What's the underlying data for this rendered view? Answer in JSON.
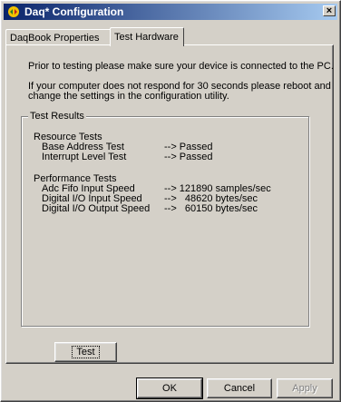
{
  "window": {
    "title": "Daq* Configuration",
    "close_glyph": "×"
  },
  "tabs": [
    {
      "label": "DaqBook Properties"
    },
    {
      "label": "Test Hardware"
    }
  ],
  "instructions": {
    "line1": "Prior to testing please make sure your device is connected to the PC.",
    "line2": "If your computer does not respond for 30 seconds please reboot and",
    "line3": "change the settings in the configuration utility."
  },
  "results": {
    "group_label": "Test Results",
    "resource_header": "Resource Tests",
    "resource": [
      {
        "name": "Base Address Test",
        "value": "--> Passed"
      },
      {
        "name": "Interrupt Level Test",
        "value": "--> Passed"
      }
    ],
    "performance_header": "Performance Tests",
    "performance": [
      {
        "name": "Adc Fifo Input Speed",
        "value": "--> 121890 samples/sec"
      },
      {
        "name": "Digital I/O Input Speed",
        "value": "-->   48620 bytes/sec"
      },
      {
        "name": "Digital I/O Output Speed",
        "value": "-->   60150 bytes/sec"
      }
    ]
  },
  "buttons": {
    "test": "Test",
    "ok": "OK",
    "cancel": "Cancel",
    "apply": "Apply"
  },
  "colors": {
    "titlebar_start": "#0a246a",
    "titlebar_end": "#a6caf0",
    "face": "#d4d0c8"
  }
}
